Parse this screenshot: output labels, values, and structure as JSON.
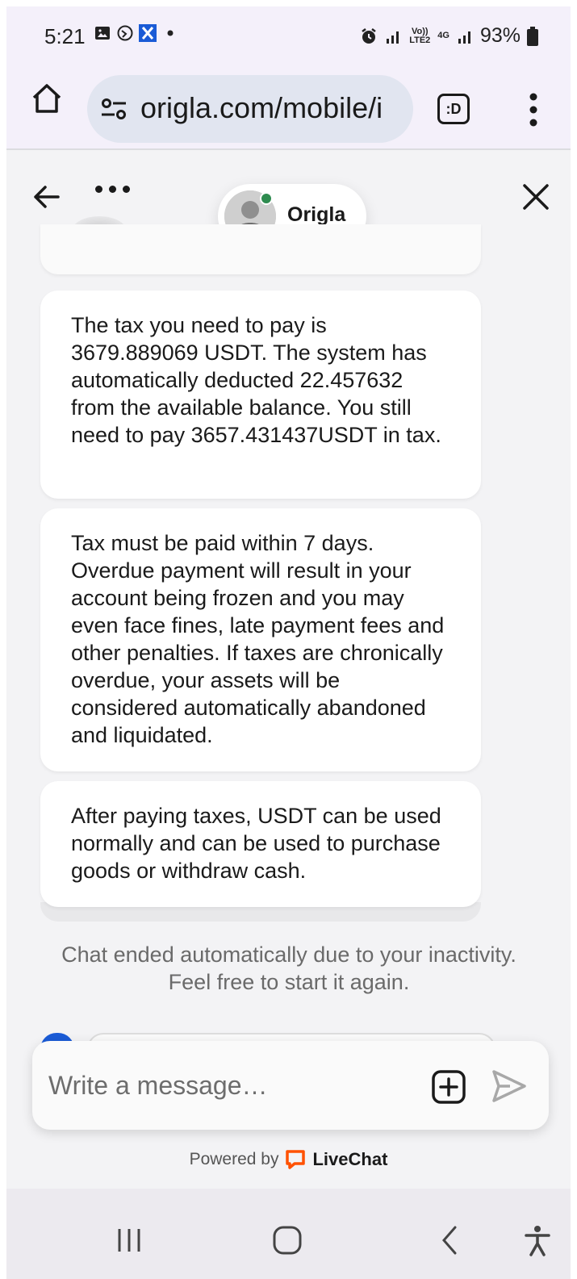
{
  "status_bar": {
    "time": "5:21",
    "network_label": "Vo)) LTE2",
    "network_4g": "4G",
    "battery": "93%"
  },
  "browser": {
    "url": "origla.com/mobile/i",
    "tab_label": ":D"
  },
  "chat": {
    "agent_name": "Origla",
    "agent_status_color": "#2e8b4f",
    "messages": [
      "The tax you need to pay is 3679.889069 USDT. The system has automatically deducted 22.457632 from the available balance. You still need to pay 3657.431437USDT in tax.",
      "Tax must be paid within 7 days. Overdue payment will result in your account being frozen and you may even face fines, late payment fees and other penalties. If taxes are chronically overdue, your assets will be considered automatically abandoned and liquidated.",
      "After paying taxes, USDT can be used normally and can be used to purchase goods or withdraw cash."
    ],
    "system_message": "Chat ended automatically due to your inactivity. Feel free to start it again."
  },
  "composer": {
    "placeholder": "Write a message…",
    "powered_by": "Powered by",
    "brand": "LiveChat",
    "brand_color": "#ff5100"
  }
}
